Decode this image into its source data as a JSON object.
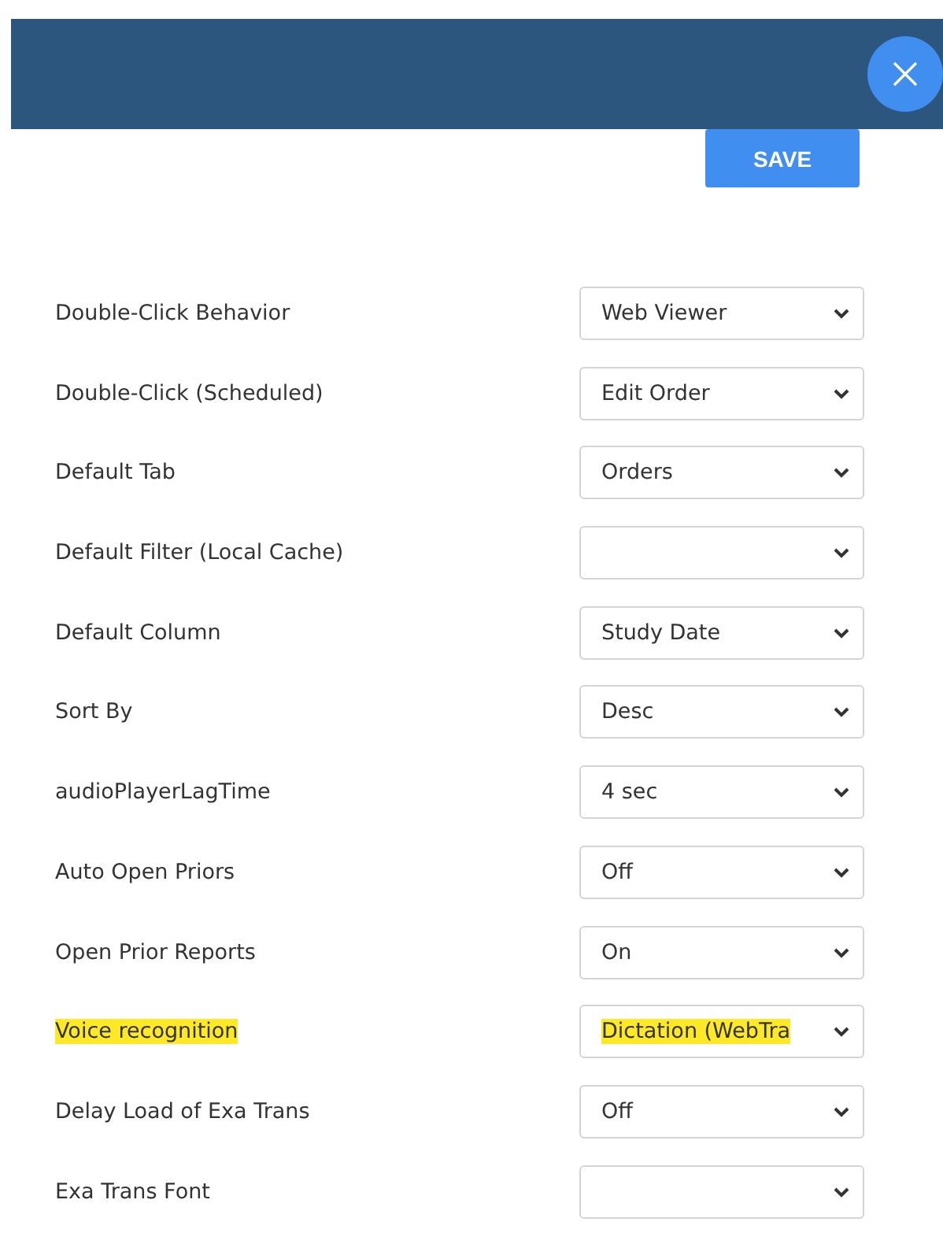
{
  "header": {
    "close": true
  },
  "save_button": "SAVE",
  "settings": [
    {
      "label": "Double-Click Behavior",
      "value": "Web Viewer",
      "highlighted": false
    },
    {
      "label": "Double-Click (Scheduled)",
      "value": "Edit Order",
      "highlighted": false
    },
    {
      "label": "Default Tab",
      "value": "Orders",
      "highlighted": false
    },
    {
      "label": "Default Filter (Local Cache)",
      "highlighted": false
    },
    {
      "label": "Default Column",
      "value": "Study Date",
      "highlighted": false
    },
    {
      "label": "Sort By",
      "value": "Desc",
      "highlighted": false
    },
    {
      "label": "audioPlayerLagTime",
      "value": "4 sec",
      "highlighted": false
    },
    {
      "label": "Auto Open Priors",
      "value": "Off",
      "highlighted": false
    },
    {
      "label": "Open Prior Reports",
      "value": "On",
      "highlighted": false
    },
    {
      "label": "Voice recognition",
      "value": "Dictation (WebTra",
      "highlighted": true
    },
    {
      "label": "Delay Load of Exa Trans",
      "value": "Off",
      "highlighted": false
    },
    {
      "label": "Exa Trans Font",
      "highlighted": false
    }
  ]
}
